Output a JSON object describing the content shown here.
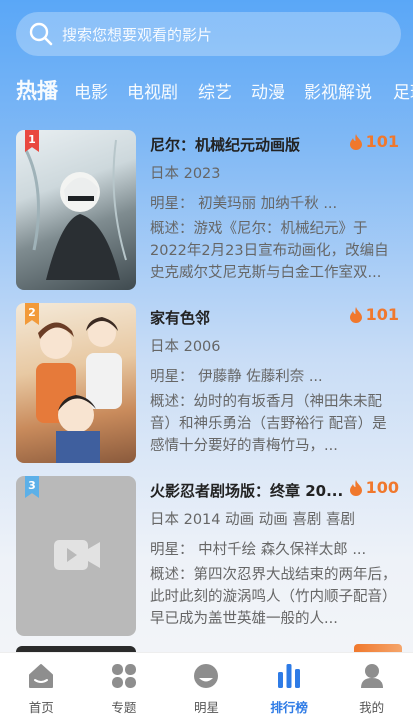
{
  "search": {
    "placeholder": "搜索您想要观看的影片",
    "icon": "search-icon"
  },
  "tabs": [
    {
      "label": "热播",
      "active": true
    },
    {
      "label": "电影"
    },
    {
      "label": "电视剧"
    },
    {
      "label": "综艺"
    },
    {
      "label": "动漫"
    },
    {
      "label": "影视解说"
    },
    {
      "label": "足球"
    }
  ],
  "list": [
    {
      "rank": "1",
      "rank_color": "#e9483f",
      "title": "尼尔：机械纪元动画版",
      "heat": "101",
      "meta": "日本 2023",
      "stars": "明星：  初美玛丽  加纳千秋  ...",
      "desc": "概述：游戏《尼尔：机械纪元》于2022年2月23日宣布动画化，改编自史克威尔艾尼克斯与白金工作室双..."
    },
    {
      "rank": "2",
      "rank_color": "#f29a3a",
      "title": "家有色邻",
      "heat": "101",
      "meta": "日本 2006",
      "stars": "明星：  伊藤静  佐藤利奈  ...",
      "desc": "概述：幼时的有坂香月（神田朱未配音）和神乐勇治（吉野裕行 配音）是感情十分要好的青梅竹马，..."
    },
    {
      "rank": "3",
      "rank_color": "#5cb0e8",
      "title": "火影忍者剧场版：终章 20...",
      "heat": "100",
      "meta": "日本 2014  动画  动画  喜剧  喜剧",
      "stars": "明星：  中村千绘  森久保祥太郎  ...",
      "desc": "概述：第四次忍界大战结束的两年后，此时此刻的漩涡鸣人（竹内顺子配音）早已成为盖世英雄一般的人..."
    }
  ],
  "nav": [
    {
      "label": "首页",
      "icon": "home-icon"
    },
    {
      "label": "专题",
      "icon": "grid-icon"
    },
    {
      "label": "明星",
      "icon": "star-person-icon"
    },
    {
      "label": "排行榜",
      "icon": "ranking-icon",
      "active": true
    },
    {
      "label": "我的",
      "icon": "profile-icon"
    }
  ],
  "colors": {
    "accent": "#2e7be6",
    "heat": "#f0782d",
    "gradient_top": "#5aa7f7"
  }
}
